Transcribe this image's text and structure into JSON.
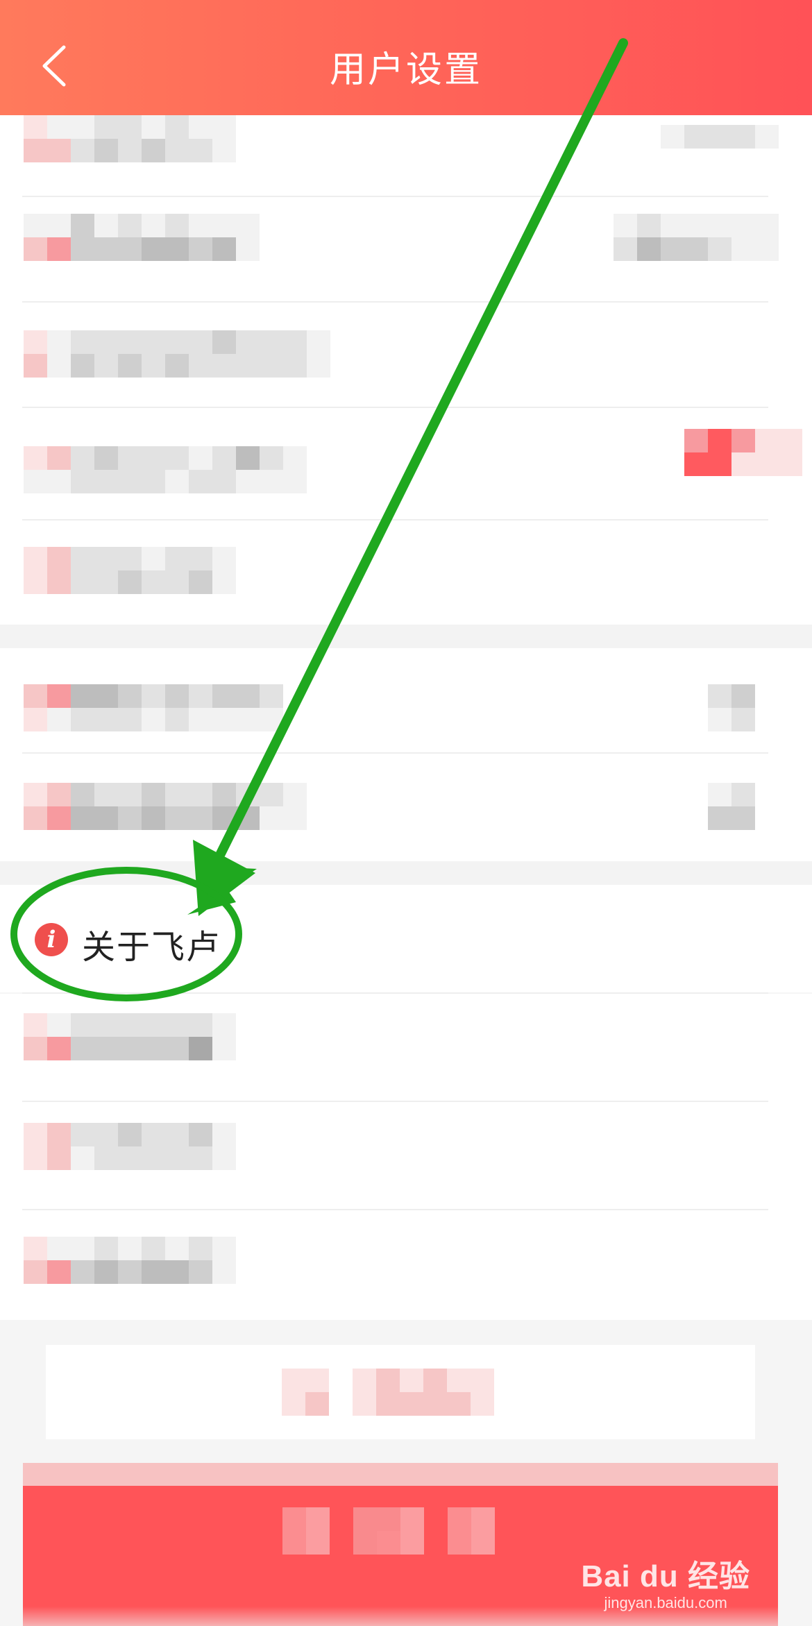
{
  "header": {
    "title": "用户设置",
    "back_icon": "chevron-left-icon"
  },
  "about": {
    "label": "关于飞卢",
    "icon": "info-icon",
    "icon_glyph": "i"
  },
  "watermark": {
    "brand": "Bai du 经验",
    "site": "jingyan.baidu.com"
  },
  "annotation": {
    "arrow_color": "#1fa81f",
    "circle_color": "#1fa81f"
  },
  "colors": {
    "header_start": "#ff7a5c",
    "header_end": "#ff5257",
    "primary_red": "#ff5458",
    "info_icon": "#ef4f4d"
  }
}
